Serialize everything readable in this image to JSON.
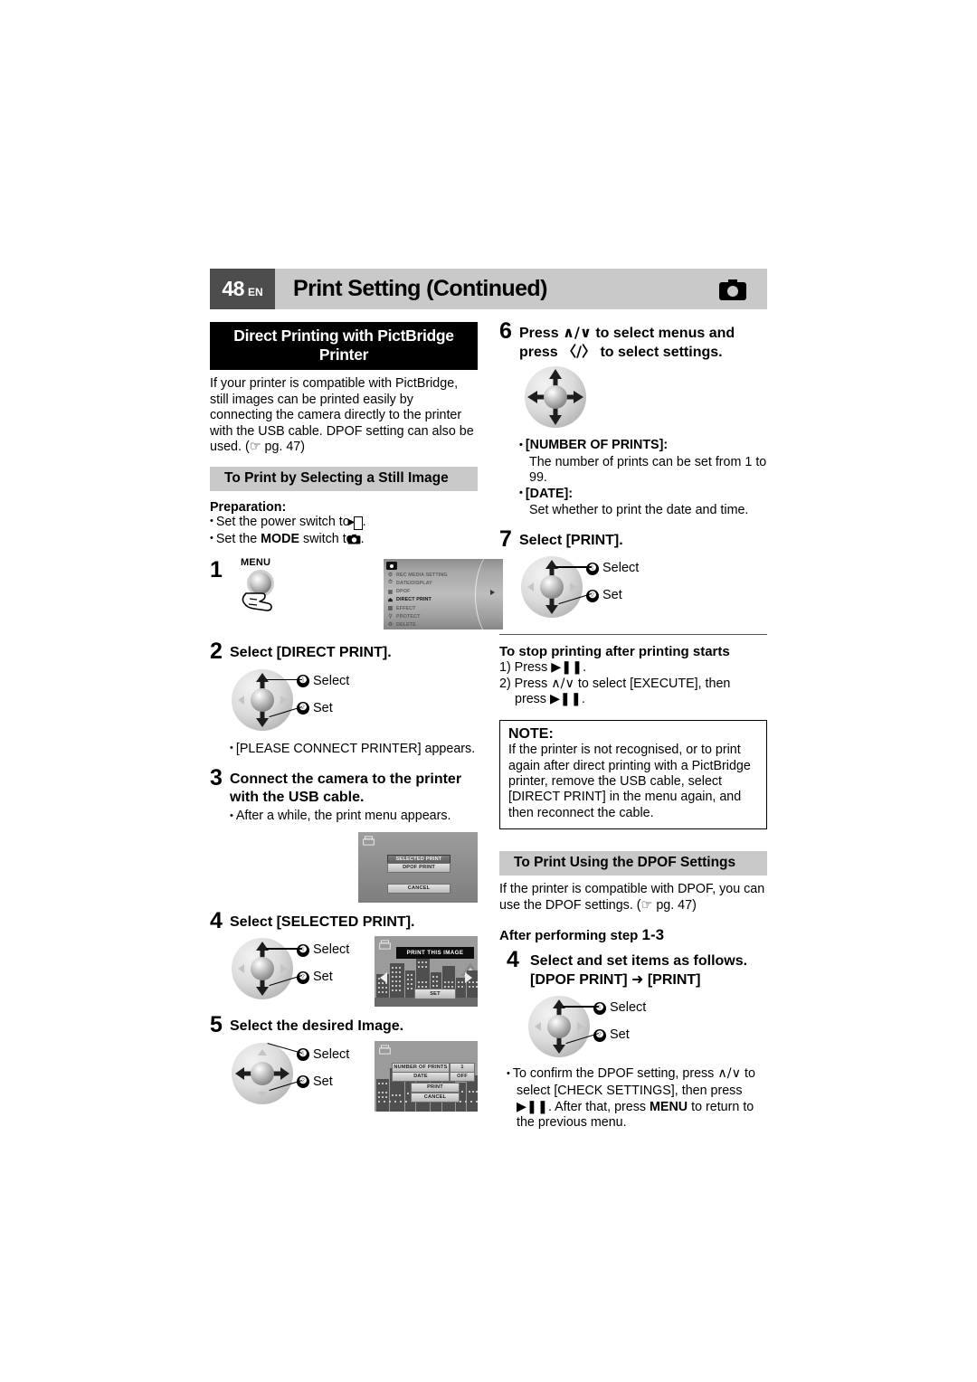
{
  "header": {
    "page_number": "48",
    "lang": "EN",
    "title": "Print Setting (Continued)",
    "icon": "still-camera-icon"
  },
  "left": {
    "section_title": "Direct Printing with PictBridge Printer",
    "intro": "If your printer is compatible with PictBridge, still images can be printed easily by connecting the camera directly to the printer with the USB cable. DPOF setting can also be used. (☞ pg. 47)",
    "subsection_title": "To Print by Selecting a Still Image",
    "preparation_label": "Preparation:",
    "prep_1_pre": "Set the power switch to ",
    "prep_1_post": ".",
    "prep_2_pre": "Set the ",
    "prep_2_bold": "MODE",
    "prep_2_mid": " switch to ",
    "prep_2_post": ".",
    "step1": {
      "number": "1",
      "button_label": "MENU",
      "menu_items": [
        {
          "label": "REC MEDIA SETTING",
          "icon": "gear-icon",
          "selected": false
        },
        {
          "label": "DATE/DISPLAY",
          "icon": "clock-icon",
          "selected": false
        },
        {
          "label": "DPOF",
          "icon": "dpof-icon",
          "selected": false
        },
        {
          "label": "DIRECT PRINT",
          "icon": "printer-icon",
          "selected": true
        },
        {
          "label": "EFFECT",
          "icon": "effect-icon",
          "selected": false
        },
        {
          "label": "PROTECT",
          "icon": "key-icon",
          "selected": false
        },
        {
          "label": "DELETE",
          "icon": "trash-icon",
          "selected": false
        }
      ]
    },
    "step2": {
      "number": "2",
      "title": "Select [DIRECT PRINT].",
      "label_1": "Select",
      "label_2": "Set",
      "num_1": "❶",
      "num_2": "❷",
      "note": "[PLEASE CONNECT PRINTER] appears."
    },
    "step3": {
      "number": "3",
      "title": "Connect the camera to the printer with the USB cable.",
      "note": "After a while, the print menu appears.",
      "screen_buttons": [
        "SELECTED PRINT",
        "DPOF PRINT",
        "CANCEL"
      ]
    },
    "step4": {
      "number": "4",
      "title": "Select [SELECTED PRINT].",
      "label_1": "Select",
      "label_2": "Set",
      "screen_banner": "PRINT THIS IMAGE",
      "screen_button": "SET"
    },
    "step5": {
      "number": "5",
      "title": "Select the desired Image.",
      "label_1": "Select",
      "label_2": "Set",
      "screen_rows": [
        {
          "name": "NUMBER OF PRINTS",
          "value": "1"
        },
        {
          "name": "DATE",
          "value": "OFF"
        }
      ],
      "screen_buttons": [
        "PRINT",
        "CANCEL"
      ]
    }
  },
  "right": {
    "step6": {
      "number": "6",
      "title_line1_a": "Press ",
      "title_line1_keys": "∧/∨",
      "title_line1_b": " to select menus and",
      "title_line2_a": "press ",
      "title_line2_keys": "〈/〉",
      "title_line2_b": " to select settings.",
      "bullets": [
        {
          "term": "[NUMBER OF PRINTS]:",
          "desc": "The number of prints can be set from 1 to 99."
        },
        {
          "term": "[DATE]:",
          "desc": "Set whether to print the date and time."
        }
      ]
    },
    "step7": {
      "number": "7",
      "title": "Select [PRINT].",
      "label_1": "Select",
      "label_2": "Set"
    },
    "stop_printing": {
      "heading": "To stop printing after printing starts",
      "line1_pre": "1) Press ",
      "line1_post": ".",
      "line2_pre": "2) Press ",
      "line2_keys": "∧/∨",
      "line2_mid": " to select [EXECUTE], then",
      "line3_pre": "press ",
      "line3_post": "."
    },
    "note": {
      "label": "NOTE:",
      "text": "If the printer is not recognised, or to print again after direct printing with a PictBridge printer, remove the USB cable, select [DIRECT PRINT] in the menu again, and then reconnect the cable."
    },
    "dpof": {
      "section_title": "To Print Using the DPOF Settings",
      "intro": "If the printer is compatible with DPOF, you can use the DPOF settings. (☞ pg. 47)",
      "after_label": "After performing step ",
      "after_range": "1-3",
      "step4": {
        "number": "4",
        "title_line1": "Select and set items as follows.",
        "title_line2_a": "[DPOF PRINT] ",
        "title_line2_arrow": "➜",
        "title_line2_b": " [PRINT]",
        "label_1": "Select",
        "label_2": "Set"
      },
      "confirm_a": "To confirm the DPOF setting, press ",
      "confirm_keys": "∧/∨",
      "confirm_b": " to select [CHECK SETTINGS], then press ",
      "confirm_c": ". After that, press ",
      "confirm_bold": "MENU",
      "confirm_d": " to return to the previous menu."
    }
  },
  "colors": {
    "header_bar": "#c9c9c9",
    "page_badge": "#4d4d4d",
    "section_black": "#000000",
    "section_gray": "#c9c9c9"
  }
}
